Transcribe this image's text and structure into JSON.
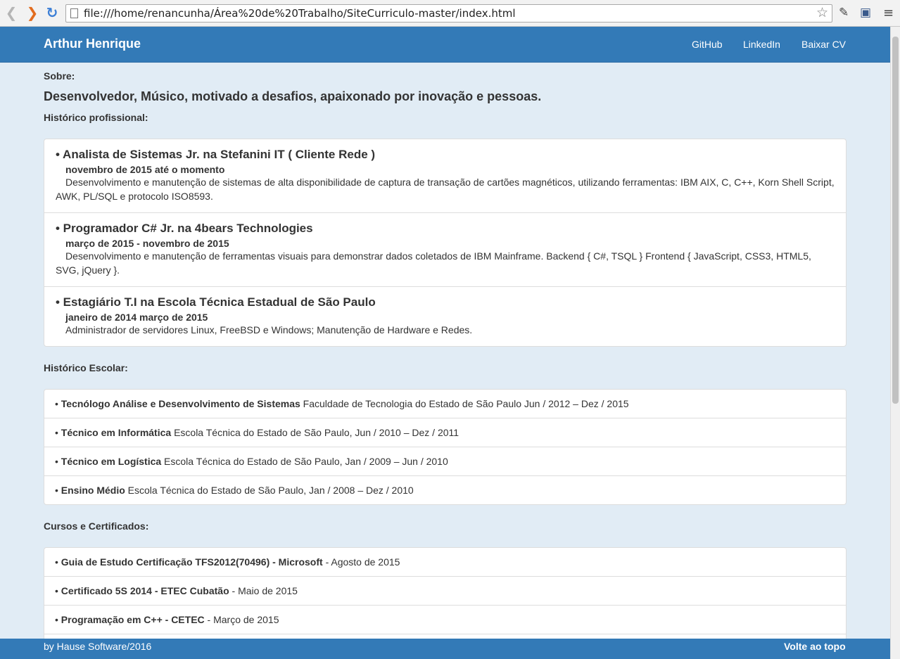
{
  "browser": {
    "url": "file:///home/renancunha/Área%20de%20Trabalho/SiteCurriculo-master/index.html"
  },
  "navbar": {
    "brand": "Arthur Henrique",
    "links": [
      "GitHub",
      "LinkedIn",
      "Baixar CV"
    ]
  },
  "about": {
    "label": "Sobre:",
    "headline": "Desenvolvedor, Músico, motivado a desafios, apaixonado por inovação e pessoas."
  },
  "work": {
    "label": "Histórico profissional:",
    "jobs": [
      {
        "title": "• Analista de Sistemas Jr. na Stefanini IT ( Cliente Rede )",
        "period": "novembro de 2015 até o momento",
        "desc": "Desenvolvimento e manutenção de sistemas de alta disponibilidade de captura de transação de cartões magnéticos, utilizando ferramentas: IBM AIX, C, C++, Korn Shell Script, AWK, PL/SQL e protocolo ISO8593."
      },
      {
        "title": "• Programador C# Jr. na 4bears Technologies",
        "period": "março de 2015 - novembro de 2015",
        "desc": "Desenvolvimento e manutenção de ferramentas visuais para demonstrar dados coletados de IBM Mainframe. Backend { C#, TSQL } Frontend { JavaScript, CSS3, HTML5, SVG, jQuery }."
      },
      {
        "title": "• Estagiário T.I na Escola Técnica Estadual de São Paulo",
        "period": "janeiro de 2014  março de 2015",
        "desc": "Administrador de servidores Linux, FreeBSD e Windows; Manutenção de Hardware e Redes."
      }
    ]
  },
  "education": {
    "label": "Histórico Escolar:",
    "items": [
      {
        "bold": "Tecnólogo Análise e Desenvolvimento de Sistemas",
        "rest": " Faculdade de Tecnologia do Estado de São Paulo  Jun / 2012 – Dez / 2015"
      },
      {
        "bold": "Técnico em Informática",
        "rest": " Escola Técnica do Estado de São Paulo, Jun / 2010 – Dez / 2011"
      },
      {
        "bold": "Técnico em Logística",
        "rest": " Escola Técnica do Estado de São Paulo,  Jan / 2009 – Jun / 2010"
      },
      {
        "bold": "Ensino Médio",
        "rest": " Escola Técnica do Estado de São Paulo,  Jan / 2008 – Dez / 2010"
      }
    ]
  },
  "courses": {
    "label": "Cursos e Certificados:",
    "items": [
      {
        "bold": "Guia de Estudo  Certificação TFS2012(70496) - Microsoft",
        "rest": " - Agosto de 2015"
      },
      {
        "bold": "Certificado 5S 2014 - ETEC Cubatão",
        "rest": " - Maio de 2015"
      },
      {
        "bold": "Programação em C++ - CETEC",
        "rest": " - Março de 2015"
      }
    ]
  },
  "footer": {
    "left": "by Hause Software/2016",
    "right": "Volte ao topo"
  }
}
